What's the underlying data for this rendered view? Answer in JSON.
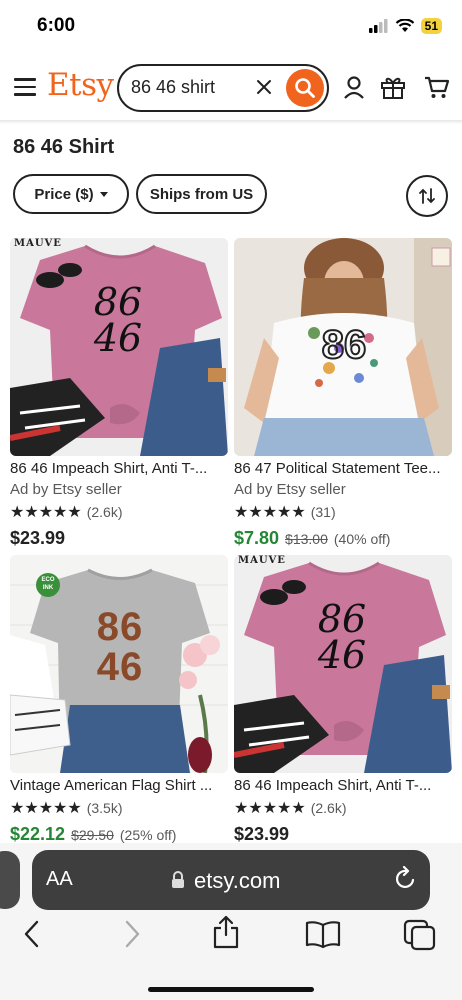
{
  "status": {
    "time": "6:00",
    "battery": "51"
  },
  "header": {
    "logo": "Etsy",
    "search_value": "86 46 shirt",
    "brand_color": "#f1641e"
  },
  "page": {
    "title": "86 46 Shirt",
    "filters": [
      {
        "label": "Price ($)"
      },
      {
        "label": "Ships from US"
      }
    ]
  },
  "listings": [
    {
      "title": "86 46 Impeach Shirt, Anti T-...",
      "ad": "Ad by Etsy seller",
      "rating_count": "(2.6k)",
      "price": "$23.99",
      "image_tag": "MAUVE",
      "shirt_text_1": "86",
      "shirt_text_2": "46"
    },
    {
      "title": "86 47 Political Statement Tee...",
      "ad": "Ad by Etsy seller",
      "rating_count": "(31)",
      "price": "$7.80",
      "original_price": "$13.00",
      "discount": "(40% off)"
    },
    {
      "title": "Vintage American Flag Shirt ...",
      "rating_count": "(3.5k)",
      "price": "$22.12",
      "original_price": "$29.50",
      "discount": "(25% off)",
      "badge": "ECO INK",
      "shirt_text_1": "86",
      "shirt_text_2": "46"
    },
    {
      "title": "86 46 Impeach Shirt, Anti T-...",
      "rating_count": "(2.6k)",
      "price": "$23.99",
      "image_tag": "MAUVE",
      "shirt_text_1": "86",
      "shirt_text_2": "46"
    }
  ],
  "browser": {
    "aa": "AA",
    "url": "etsy.com"
  },
  "stars": "★★★★★"
}
